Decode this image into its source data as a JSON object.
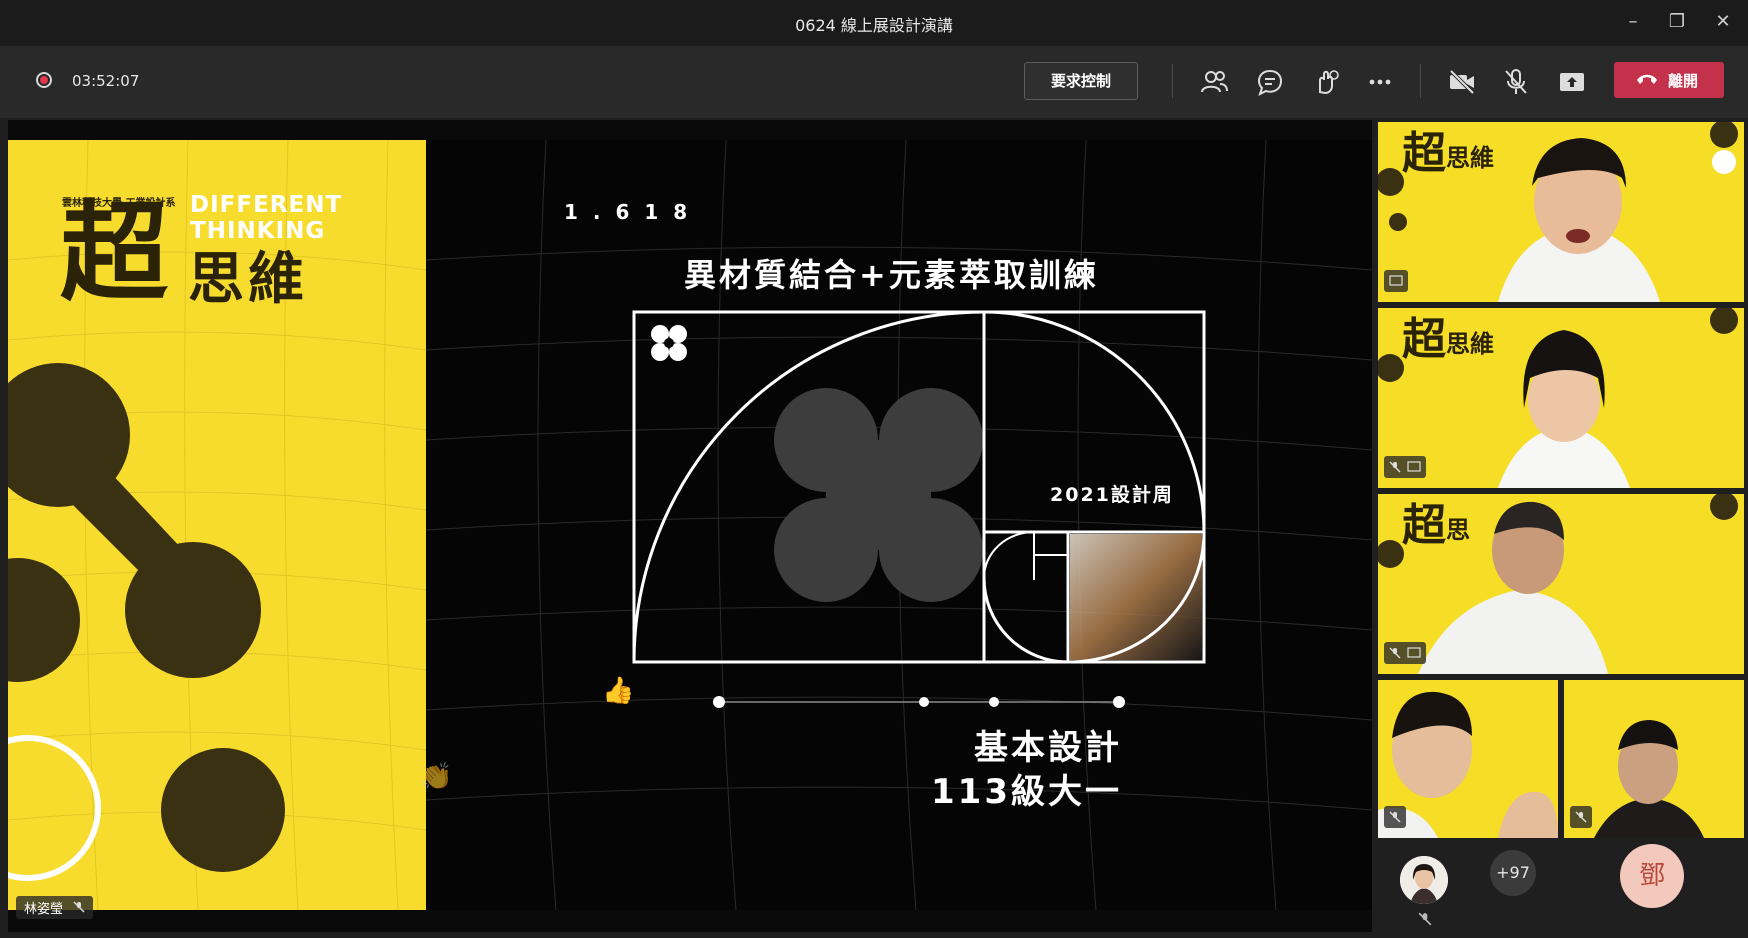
{
  "window": {
    "title": "0624 線上展設計演講",
    "minimize": "–",
    "maximize": "❐",
    "close": "✕"
  },
  "toolbar": {
    "timer": "03:52:07",
    "request_control": "要求控制",
    "leave": "離開",
    "icons": [
      "people-icon",
      "chat-icon",
      "reactions-icon",
      "more-icon",
      "camera-off-icon",
      "mic-off-icon",
      "share-icon",
      "phone-hangup-icon"
    ],
    "leave_color": "#c4314b"
  },
  "slide": {
    "left": {
      "school": "雲林科技大學 工業設計系",
      "big_char": "超",
      "title_rest": "思維",
      "en_line1": "DIFFERENT",
      "en_line2": "THINKING",
      "accent": "#f7dc2e"
    },
    "right": {
      "golden": "1 . 6 1 8",
      "heading": "異材質結合+元素萃取訓練",
      "event": "2021設計周",
      "course": "基本設計",
      "cohort": "113級大一"
    }
  },
  "presenter": {
    "name": "林姿瑩"
  },
  "participants": {
    "others_count": "+97",
    "self_initial": "鄧"
  },
  "reactions": {
    "thumbs": "👍",
    "clap": "👏"
  }
}
